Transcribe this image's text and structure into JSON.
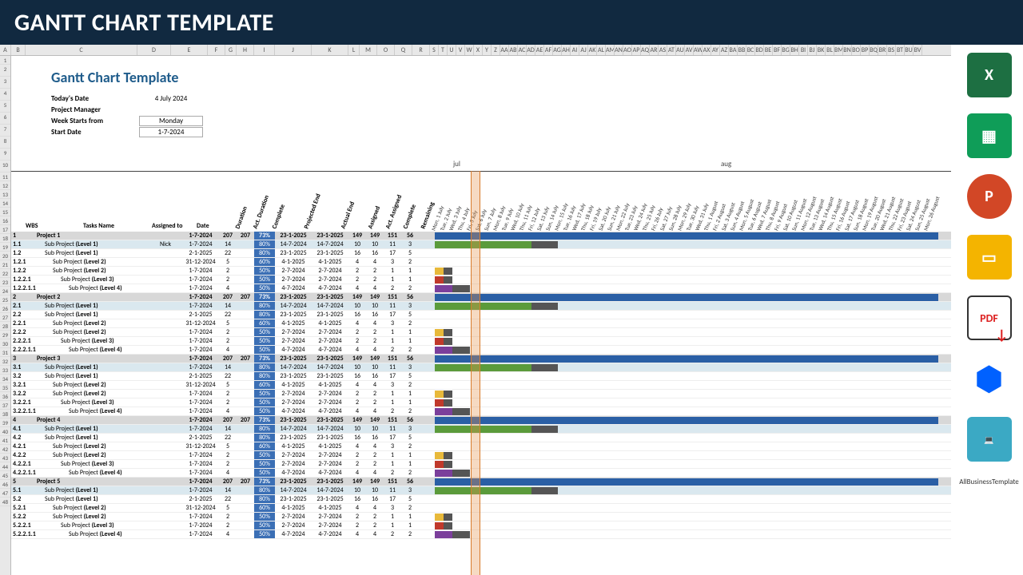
{
  "banner": "GANTT CHART TEMPLATE",
  "title": "Gantt Chart Template",
  "meta": {
    "today_k": "Today's Date",
    "today_v": "4 July 2024",
    "pm_k": "Project Manager",
    "pm_v": "",
    "week_k": "Week Starts from",
    "week_v": "Monday",
    "start_k": "Start Date",
    "start_v": "1-7-2024"
  },
  "months": {
    "jul": "jul",
    "aug": "aug"
  },
  "colLetters": [
    "A",
    "B",
    "C",
    "D",
    "E",
    "F",
    "G",
    "H",
    "I",
    "J",
    "K",
    "L",
    "M",
    "O",
    "Q",
    "R",
    "S",
    "T",
    "U",
    "V",
    "W",
    "X",
    "Y",
    "Z",
    "AA",
    "AB",
    "AC",
    "AD",
    "AE",
    "AF",
    "AG",
    "AH",
    "AI",
    "AJ",
    "AK",
    "AL",
    "AM",
    "AN",
    "AO",
    "AP",
    "AQ",
    "AR",
    "AS",
    "AT",
    "AU",
    "AV",
    "AW",
    "AX",
    "AY",
    "AZ",
    "BA",
    "BB",
    "BC",
    "BD",
    "BE",
    "BF",
    "BG",
    "BH",
    "BI",
    "BJ",
    "BK",
    "BL",
    "BM",
    "BN",
    "BO",
    "BP",
    "BQ",
    "BR",
    "BS",
    "BT",
    "BU",
    "BV"
  ],
  "headers": {
    "wbs": "WBS",
    "task": "Tasks Name",
    "assn": "Assigned to",
    "date": "Date",
    "dur": "Duration",
    "adur": "Act. Duration",
    "comp": "Complete",
    "pend": "Projected End",
    "aend": "Actual End",
    "asg": "Assigned",
    "aasg": "Act. Assigned",
    "cpl": "Complete",
    "rem": "Remaining"
  },
  "dates": [
    "Mon, 1 July",
    "Tue, 2 July",
    "Wed, 3 July",
    "Thu, 4 July",
    "Fri, 5 July",
    "Sat, 6 July",
    "Sun, 7 July",
    "Mon, 8 July",
    "Tue, 9 July",
    "Wed, 10 July",
    "Thu, 11 July",
    "Fri, 12 July",
    "Sat, 13 July",
    "Sun, 14 July",
    "Mon, 15 July",
    "Tue, 16 July",
    "Wed, 17 July",
    "Thu, 18 July",
    "Fri, 19 July",
    "Sat, 20 July",
    "Sun, 21 July",
    "Mon, 22 July",
    "Tue, 23 July",
    "Wed, 24 July",
    "Thu, 25 July",
    "Fri, 26 July",
    "Sat, 27 July",
    "Sun, 28 July",
    "Mon, 29 July",
    "Tue, 30 July",
    "Wed, 31 July",
    "Thu, 1 August",
    "Fri, 2 August",
    "Sat, 3 August",
    "Sun, 4 August",
    "Mon, 5 August",
    "Tue, 6 August",
    "Wed, 7 August",
    "Thu, 8 August",
    "Fri, 9 August",
    "Sat, 10 August",
    "Sun, 11 August",
    "Mon, 12 August",
    "Tue, 13 August",
    "Wed, 14 August",
    "Thu, 15 August",
    "Fri, 16 August",
    "Sat, 17 August",
    "Sun, 18 August",
    "Mon, 19 August",
    "Tue, 20 August",
    "Wed, 21 August",
    "Thu, 22 August",
    "Fri, 23 August",
    "Sat, 24 August",
    "Sun, 25 August",
    "Mon, 26 August"
  ],
  "group": [
    {
      "t": "proj",
      "wbs": "",
      "task": "Project",
      "date": "1-7-2024",
      "dur": "207",
      "adur": "207",
      "comp": "73%",
      "pend": "23-1-2025",
      "aend": "23-1-2025",
      "asg": "149",
      "aasg": "149",
      "cpl": "151",
      "rem": "56",
      "assn": "",
      "lvl": 0
    },
    {
      "t": "sub1",
      "wbs": ".1",
      "task": "Sub Project (Level 1)",
      "assn": "Nick",
      "date": "1-7-2024",
      "dur": "14",
      "adur": "",
      "comp": "80%",
      "pend": "14-7-2024",
      "aend": "14-7-2024",
      "asg": "10",
      "aasg": "10",
      "cpl": "11",
      "rem": "3",
      "lvl": 1,
      "only1": true
    },
    {
      "t": "",
      "wbs": ".2",
      "task": "Sub Project (Level 1)",
      "assn": "",
      "date": "2-1-2025",
      "dur": "22",
      "adur": "",
      "comp": "80%",
      "pend": "23-1-2025",
      "aend": "23-1-2025",
      "asg": "16",
      "aasg": "16",
      "cpl": "17",
      "rem": "5",
      "lvl": 1
    },
    {
      "t": "",
      "wbs": ".2.1",
      "task": "Sub Project (Level 2)",
      "assn": "",
      "date": "31-12-2024",
      "dur": "5",
      "adur": "",
      "comp": "60%",
      "pend": "4-1-2025",
      "aend": "4-1-2025",
      "asg": "4",
      "aasg": "4",
      "cpl": "3",
      "rem": "2",
      "lvl": 2
    },
    {
      "t": "",
      "wbs": ".2.2",
      "task": "Sub Project (Level 2)",
      "assn": "",
      "date": "1-7-2024",
      "dur": "2",
      "adur": "",
      "comp": "50%",
      "pend": "2-7-2024",
      "aend": "2-7-2024",
      "asg": "2",
      "aasg": "2",
      "cpl": "1",
      "rem": "1",
      "lvl": 2
    },
    {
      "t": "",
      "wbs": ".2.2.1",
      "task": "Sub Project (Level 3)",
      "assn": "",
      "date": "1-7-2024",
      "dur": "2",
      "adur": "",
      "comp": "50%",
      "pend": "2-7-2024",
      "aend": "2-7-2024",
      "asg": "2",
      "aasg": "2",
      "cpl": "1",
      "rem": "1",
      "lvl": 3
    },
    {
      "t": "",
      "wbs": ".2.2.1.1",
      "task": "Sub Project (Level 4)",
      "assn": "",
      "date": "1-7-2024",
      "dur": "4",
      "adur": "",
      "comp": "50%",
      "pend": "4-7-2024",
      "aend": "4-7-2024",
      "asg": "4",
      "aasg": "4",
      "cpl": "2",
      "rem": "2",
      "lvl": 4
    }
  ],
  "projectNums": [
    "1",
    "2",
    "3",
    "4",
    "5"
  ],
  "projectName": "Project ",
  "sideIcons": [
    "excel",
    "sheets",
    "ppt",
    "slides",
    "pdf",
    "dropbox",
    "abt"
  ],
  "abtLabel": "AllBusinessTemplate"
}
